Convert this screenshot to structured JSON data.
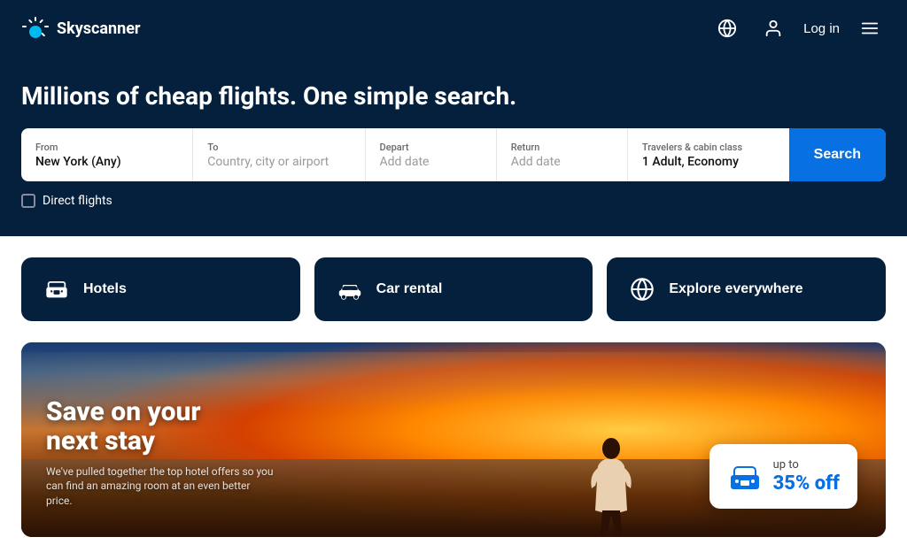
{
  "app": {
    "name": "Skyscanner"
  },
  "navbar": {
    "logo_text": "Skyscanner",
    "login_label": "Log in"
  },
  "hero": {
    "title": "Millions of cheap flights. One simple search."
  },
  "search": {
    "from_label": "From",
    "from_value": "New York (Any)",
    "to_label": "To",
    "to_placeholder": "Country, city or airport",
    "depart_label": "Depart",
    "depart_placeholder": "Add date",
    "return_label": "Return",
    "return_placeholder": "Add date",
    "travelers_label": "Travelers & cabin class",
    "travelers_value": "1 Adult, Economy",
    "search_button": "Search"
  },
  "direct_flights": {
    "label": "Direct flights"
  },
  "categories": [
    {
      "id": "hotels",
      "label": "Hotels",
      "icon": "hotel-icon"
    },
    {
      "id": "car-rental",
      "label": "Car rental",
      "icon": "car-icon"
    },
    {
      "id": "explore",
      "label": "Explore everywhere",
      "icon": "globe-icon"
    }
  ],
  "hotel_banner": {
    "title_line1": "Save on your",
    "title_line2": "next stay",
    "subtitle": "We've pulled together the top hotel offers so you can find an amazing room at an even better price.",
    "discount_prefix": "up to",
    "discount_value": "35% off"
  }
}
